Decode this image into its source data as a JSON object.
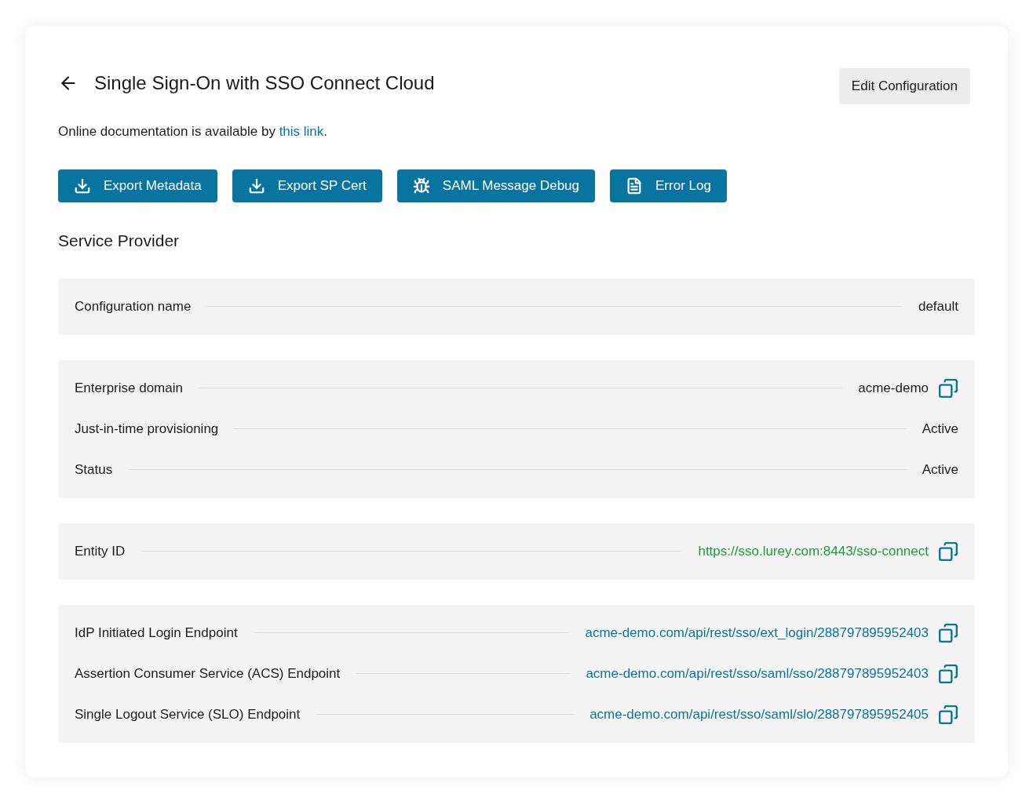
{
  "header": {
    "title": "Single Sign-On with SSO Connect Cloud",
    "edit_button": "Edit Configuration"
  },
  "doc_note": {
    "text": "Online documentation is available by",
    "link": "this link",
    "suffix": "."
  },
  "actions": [
    {
      "label": "Export Metadata"
    },
    {
      "label": "Export SP Cert"
    },
    {
      "label": "SAML Message Debug"
    },
    {
      "label": "Error Log"
    }
  ],
  "section_title": "Service Provider",
  "groups": [
    {
      "rows": [
        {
          "label": "Configuration name",
          "value": "default",
          "kind": "plain",
          "copyable": false
        }
      ]
    },
    {
      "rows": [
        {
          "label": "Enterprise domain",
          "value": "acme-demo",
          "kind": "plain",
          "copyable": true
        },
        {
          "label": "Just-in-time provisioning",
          "value": "Active",
          "kind": "plain",
          "copyable": false
        },
        {
          "label": "Status",
          "value": "Active",
          "kind": "plain",
          "copyable": false
        }
      ]
    },
    {
      "rows": [
        {
          "label": "Entity ID",
          "value": "https://sso.lurey.com:8443/sso-connect",
          "kind": "url",
          "copyable": true
        }
      ]
    },
    {
      "rows": [
        {
          "label": "IdP Initiated Login Endpoint",
          "value": "acme-demo.com/api/rest/sso/ext_login/288797895952403",
          "kind": "link",
          "copyable": true
        },
        {
          "label": "Assertion Consumer Service (ACS) Endpoint",
          "value": "acme-demo.com/api/rest/sso/saml/sso/288797895952403",
          "kind": "link",
          "copyable": true
        },
        {
          "label": "Single Logout Service (SLO) Endpoint",
          "value": "acme-demo.com/api/rest/sso/saml/slo/288797895952405",
          "kind": "link",
          "copyable": true
        }
      ]
    }
  ]
}
